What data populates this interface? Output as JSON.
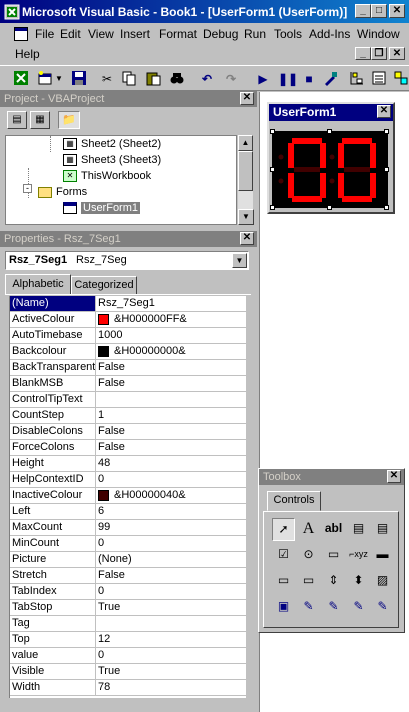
{
  "window": {
    "title": "Microsoft Visual Basic - Book1 - [UserForm1 (UserForm)]"
  },
  "menu": [
    "File",
    "Edit",
    "View",
    "Insert",
    "Format",
    "Debug",
    "Run",
    "Tools",
    "Add-Ins",
    "Window",
    "Help"
  ],
  "project": {
    "title": "Project - VBAProject",
    "items": [
      "Sheet2 (Sheet2)",
      "Sheet3 (Sheet3)",
      "ThisWorkbook",
      "Forms",
      "UserForm1"
    ]
  },
  "properties": {
    "title": "Properties - Rsz_7Seg1",
    "object_name": "Rsz_7Seg1",
    "object_type": "Rsz_7Seg",
    "tabs": [
      "Alphabetic",
      "Categorized"
    ],
    "rows": [
      {
        "name": "(Name)",
        "value": "Rsz_7Seg1"
      },
      {
        "name": "ActiveColour",
        "value": "&H000000FF&",
        "color": "#ff0000"
      },
      {
        "name": "AutoTimebase",
        "value": "1000"
      },
      {
        "name": "Backcolour",
        "value": "&H00000000&",
        "color": "#000000"
      },
      {
        "name": "BackTransparent",
        "value": "False"
      },
      {
        "name": "BlankMSB",
        "value": "False"
      },
      {
        "name": "ControlTipText",
        "value": ""
      },
      {
        "name": "CountStep",
        "value": "1"
      },
      {
        "name": "DisableColons",
        "value": "False"
      },
      {
        "name": "ForceColons",
        "value": "False"
      },
      {
        "name": "Height",
        "value": "48"
      },
      {
        "name": "HelpContextID",
        "value": "0"
      },
      {
        "name": "InactiveColour",
        "value": "&H00000040&",
        "color": "#400000"
      },
      {
        "name": "Left",
        "value": "6"
      },
      {
        "name": "MaxCount",
        "value": "99"
      },
      {
        "name": "MinCount",
        "value": "0"
      },
      {
        "name": "Picture",
        "value": "(None)"
      },
      {
        "name": "Stretch",
        "value": "False"
      },
      {
        "name": "TabIndex",
        "value": "0"
      },
      {
        "name": "TabStop",
        "value": "True"
      },
      {
        "name": "Tag",
        "value": ""
      },
      {
        "name": "Top",
        "value": "12"
      },
      {
        "name": "value",
        "value": "0"
      },
      {
        "name": "Visible",
        "value": "True"
      },
      {
        "name": "Width",
        "value": "78"
      }
    ]
  },
  "userform": {
    "title": "UserForm1"
  },
  "toolbox": {
    "title": "Toolbox",
    "tab": "Controls"
  },
  "colors": {
    "title_start": "#000080",
    "title_end": "#1084d0",
    "segment_on": "#ff0000",
    "segment_off": "#400000"
  }
}
